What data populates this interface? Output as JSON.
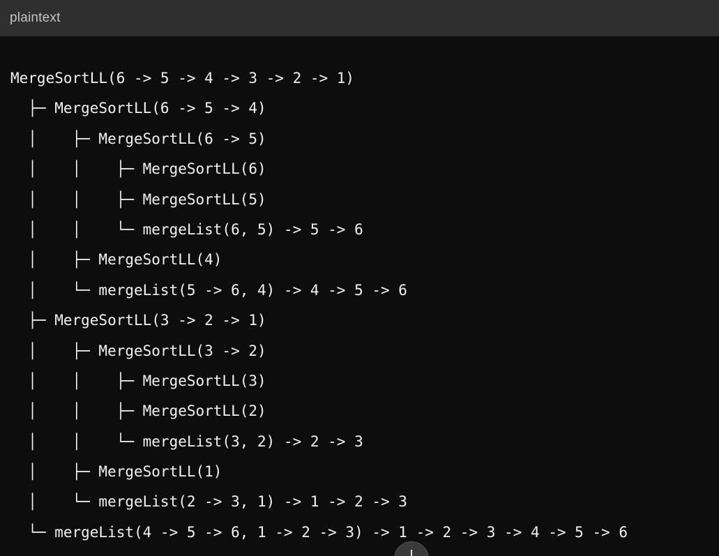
{
  "header": {
    "language": "plaintext"
  },
  "code": {
    "lines": [
      "MergeSortLL(6 -> 5 -> 4 -> 3 -> 2 -> 1)",
      "  ├─ MergeSortLL(6 -> 5 -> 4)",
      "  │    ├─ MergeSortLL(6 -> 5)",
      "  │    │    ├─ MergeSortLL(6)",
      "  │    │    ├─ MergeSortLL(5)",
      "  │    │    └─ mergeList(6, 5) -> 5 -> 6",
      "  │    ├─ MergeSortLL(4)",
      "  │    └─ mergeList(5 -> 6, 4) -> 4 -> 5 -> 6",
      "  ├─ MergeSortLL(3 -> 2 -> 1)",
      "  │    ├─ MergeSortLL(3 -> 2)",
      "  │    │    ├─ MergeSortLL(3)",
      "  │    │    ├─ MergeSortLL(2)",
      "  │    │    └─ mergeList(3, 2) -> 2 -> 3",
      "  │    ├─ MergeSortLL(1)",
      "  │    └─ mergeList(2 -> 3, 1) -> 1 -> 2 -> 3",
      "  └─ mergeList(4 -> 5 -> 6, 1 -> 2 -> 3) -> 1 -> 2 -> 3 -> 4 -> 5 -> 6"
    ]
  },
  "scroll_button": {
    "icon": "arrow-down-icon"
  }
}
